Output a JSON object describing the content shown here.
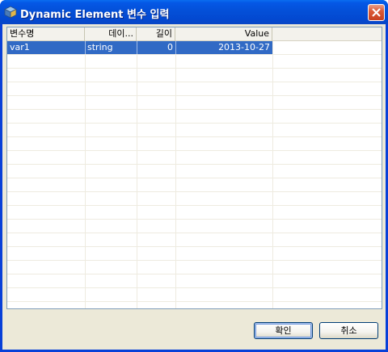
{
  "window": {
    "title": "Dynamic Element 변수 입력",
    "icon": "app-cube-icon",
    "close_icon": "close-icon",
    "accent": "#0450d8",
    "close_color": "#db5a37"
  },
  "grid": {
    "columns": [
      "변수명",
      "데이...",
      "길이",
      "Value"
    ],
    "rows": [
      {
        "name": "var1",
        "type": "string",
        "length": "0",
        "value": "2013-10-27",
        "selected": true
      }
    ],
    "selection_color": "#316ac5"
  },
  "buttons": {
    "ok_label": "확인",
    "cancel_label": "취소"
  }
}
